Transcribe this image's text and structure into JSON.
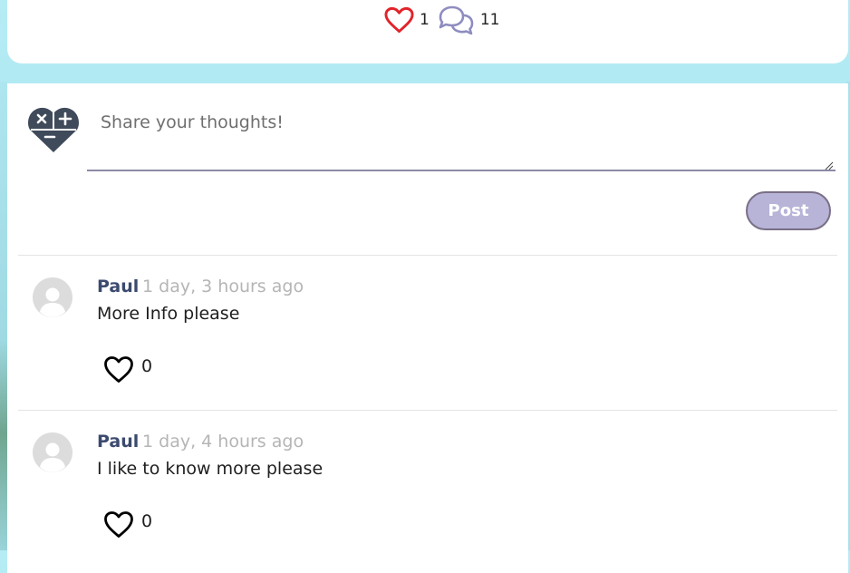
{
  "post_stats": {
    "likes_count": "1",
    "comments_count": "11"
  },
  "composer": {
    "placeholder": "Share your thoughts!",
    "post_label": "Post"
  },
  "comments": [
    {
      "author": "Paul",
      "time": "1 day, 3 hours ago",
      "text": "More Info please",
      "likes": "0"
    },
    {
      "author": "Paul",
      "time": "1 day, 4 hours ago",
      "text": "I like to know more please",
      "likes": "0"
    }
  ],
  "colors": {
    "like_heart": "#e0242b",
    "comment_bubble": "#8e8cc0",
    "author_name": "#3b4a6e",
    "timestamp": "#b5b5b5",
    "post_button": "#b7b4d8"
  }
}
